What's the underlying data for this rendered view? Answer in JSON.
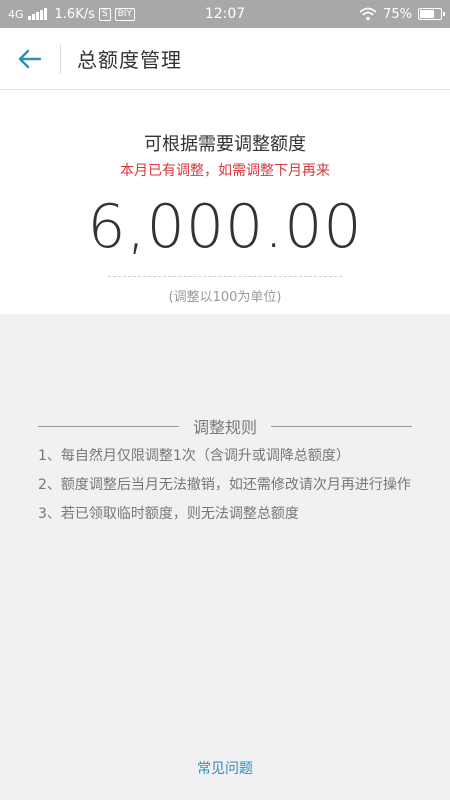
{
  "status_bar": {
    "network": "4G",
    "speed": "1.6K/s",
    "icon_labels": [
      "S",
      "BIY"
    ],
    "time": "12:07",
    "battery_percent": "75%",
    "battery_level": 0.75
  },
  "header": {
    "back_icon": "arrow-left-icon",
    "title": "总额度管理"
  },
  "main": {
    "hint": "可根据需要调整额度",
    "warning": "本月已有调整，如需调整下月再来",
    "amount": "6,000.00",
    "unit_note": "(调整以100为单位)"
  },
  "rules": {
    "title": "调整规则",
    "items": [
      "1、每自然月仅限调整1次（含调升或调降总额度）",
      "2、额度调整后当月无法撤销，如还需修改请次月再进行操作",
      "3、若已领取临时额度，则无法调整总额度"
    ]
  },
  "footer": {
    "faq_label": "常见问题"
  },
  "colors": {
    "accent": "#2e8fb8",
    "warning": "#d9363e",
    "background": "#f1f1f3"
  }
}
